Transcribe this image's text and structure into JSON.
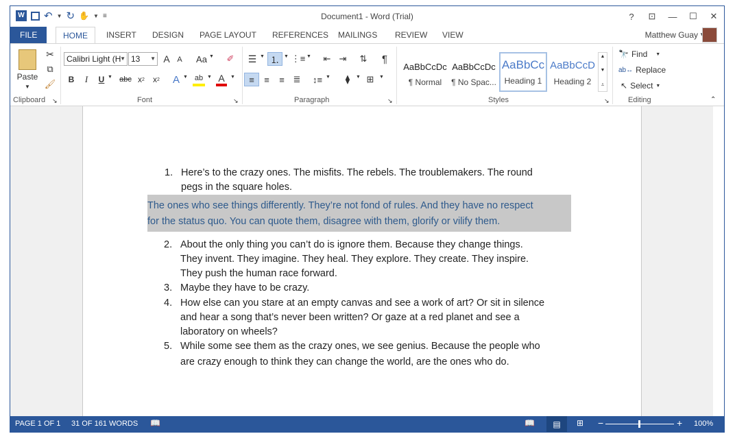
{
  "window": {
    "title": "Document1 - Word (Trial)",
    "help": "?"
  },
  "tabs": [
    "FILE",
    "HOME",
    "INSERT",
    "DESIGN",
    "PAGE LAYOUT",
    "REFERENCES",
    "MAILINGS",
    "REVIEW",
    "VIEW"
  ],
  "user": {
    "name": "Matthew Guay"
  },
  "clipboard": {
    "label": "Clipboard",
    "paste": "Paste"
  },
  "font": {
    "label": "Font",
    "name": "Calibri Light (H",
    "size": "13",
    "grow": "A",
    "shrink": "A",
    "case": "Aa",
    "bold": "B",
    "italic": "I",
    "underline": "U",
    "strike": "abc",
    "sub": "x",
    "sub2": "2",
    "sup": "x",
    "sup2": "2",
    "effects": "A",
    "highlight": "ab",
    "color": "A"
  },
  "paragraph": {
    "label": "Paragraph",
    "pilcrow": "¶"
  },
  "styles": {
    "label": "Styles",
    "items": [
      {
        "preview": "AaBbCcDc",
        "name": "¶ Normal"
      },
      {
        "preview": "AaBbCcDc",
        "name": "¶ No Spac..."
      },
      {
        "preview": "AaBbCc",
        "name": "Heading 1"
      },
      {
        "preview": "AaBbCcD",
        "name": "Heading 2"
      }
    ]
  },
  "editing": {
    "label": "Editing",
    "find": "Find",
    "replace": "Replace",
    "select": "Select"
  },
  "document": {
    "item1": {
      "num": "1.",
      "line1": "Here’s to the crazy ones. The misfits. The rebels. The troublemakers. The round",
      "line2": "pegs in the square holes."
    },
    "selected": {
      "line1": "The ones who see things differently. They’re not fond of rules. And they have no respect",
      "line2": "for the status quo. You can quote them, disagree with them, glorify or vilify them."
    },
    "item2": {
      "num": "2.",
      "line1": "About the only thing you can’t do is ignore them. Because they change things.",
      "line2": "They invent. They imagine. They heal. They explore. They create. They inspire.",
      "line3": "They push the human race forward."
    },
    "item3": {
      "num": "3.",
      "line1": "Maybe they have to be crazy."
    },
    "item4": {
      "num": "4.",
      "line1": "How else can you stare at an empty canvas and see a work of art? Or sit in silence",
      "line2": "and hear a song that’s never been written? Or gaze at a red planet and see a",
      "line3": "laboratory on wheels?"
    },
    "item5": {
      "num": "5.",
      "line1": "While some see them as the crazy ones, we see genius. Because the people who",
      "line2": "are crazy enough to think they can change the world, are the ones who do."
    }
  },
  "status": {
    "page": "PAGE 1 OF 1",
    "words": "31 OF 161 WORDS",
    "zoom": "100%",
    "zoom_percent": 100
  },
  "colors": {
    "accent": "#2b579a",
    "selection": "#c8c8c8",
    "selected_text": "#2e5a8c"
  }
}
